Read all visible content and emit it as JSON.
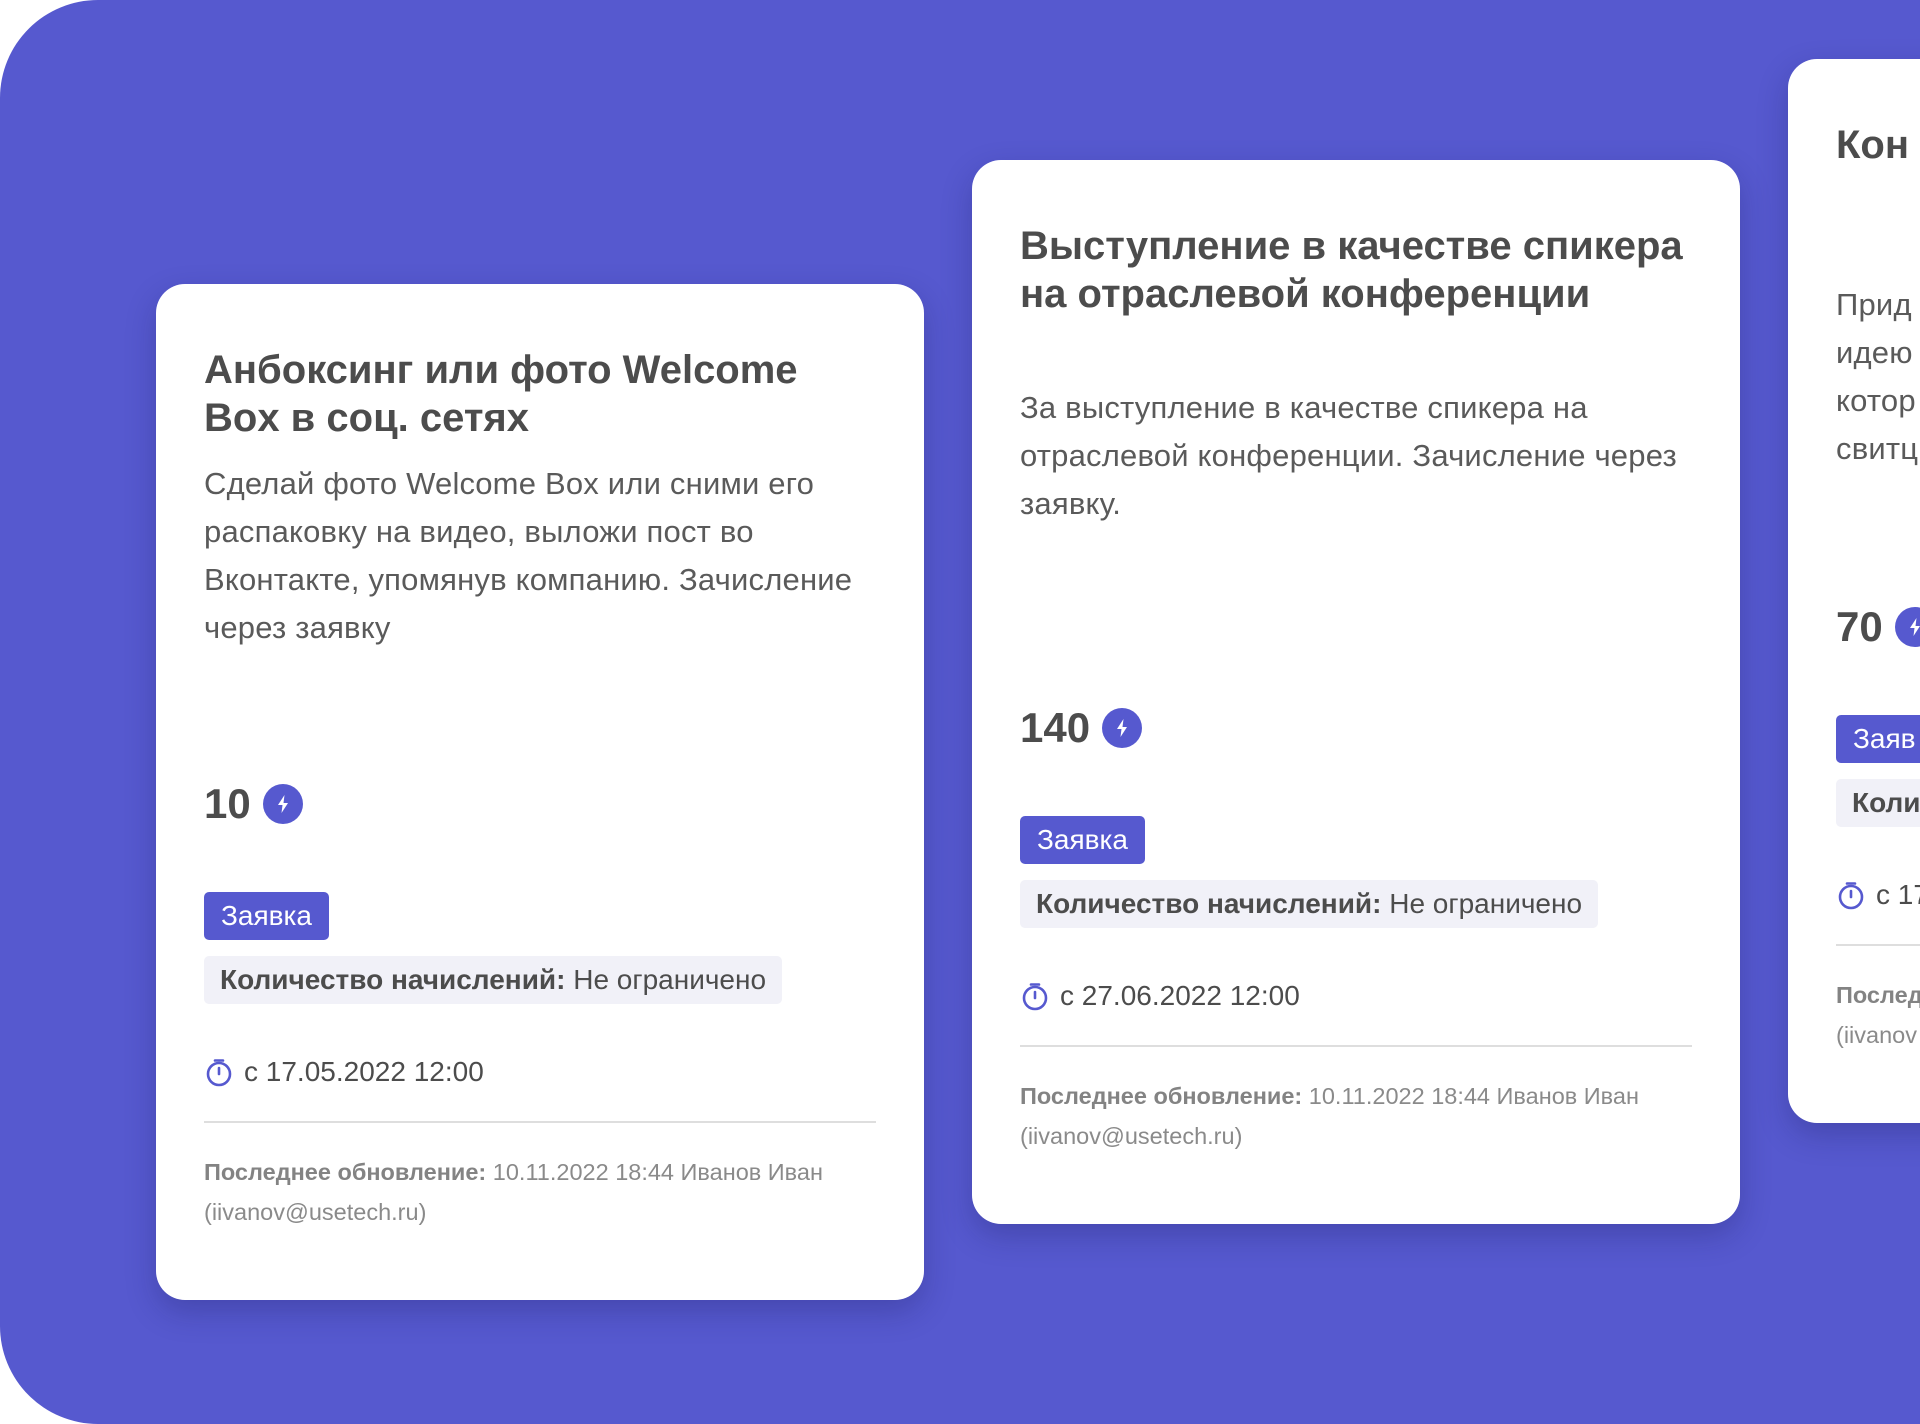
{
  "cards": [
    {
      "title": "Анбоксинг или фото Welcome Box в соц. сетях",
      "description": "Сделай фото Welcome Box или сними его распаковку на видео, выложи пост во Вконтакте, упомянув компанию. Зачисление через заявку",
      "points": "10",
      "points_icon": "lightning-icon",
      "tag": "Заявка",
      "limit_label": "Количество начислений:",
      "limit_value": "Не ограничено",
      "date_icon": "timer-icon",
      "date": "с 17.05.2022 12:00",
      "updated_label": "Последнее обновление:",
      "updated_value": "10.11.2022 18:44 Иванов Иван (iivanov@usetech.ru)"
    },
    {
      "title": "Выступление в качестве спикера на отраслевой конференции",
      "description": "За выступление в качестве спикера на отраслевой конференции. Зачисление через заявку.",
      "points": "140",
      "points_icon": "lightning-icon",
      "tag": "Заявка",
      "limit_label": "Количество начислений:",
      "limit_value": "Не ограничено",
      "date_icon": "timer-icon",
      "date": "с 27.06.2022 12:00",
      "updated_label": "Последнее обновление:",
      "updated_value": "10.11.2022 18:44 Иванов Иван (iivanov@usetech.ru)"
    },
    {
      "title": "Кон",
      "description_lines": [
        "Прид",
        "идею",
        "котор",
        "свитц"
      ],
      "points": "70",
      "points_icon": "lightning-icon",
      "tag": "Заяв",
      "limit_label": "Коли",
      "date_icon": "timer-icon",
      "date": "с 17",
      "updated_label": "Послед",
      "updated_value": "(iivanov"
    }
  ],
  "colors": {
    "background": "#5659cf",
    "card": "#ffffff",
    "accent": "#5659cf",
    "text": "#4c4c4c",
    "muted": "#8a8a8a",
    "chip": "#f1f1f8"
  }
}
